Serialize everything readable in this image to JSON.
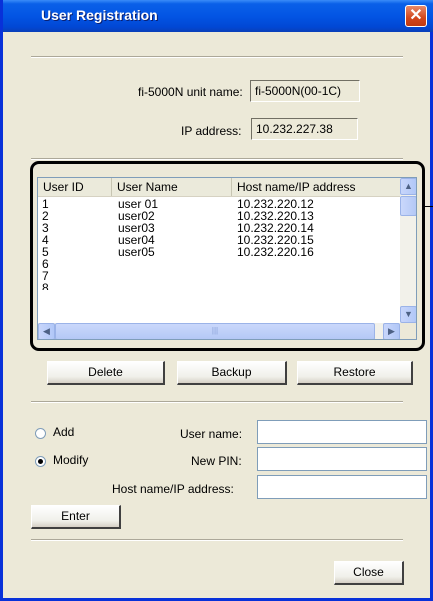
{
  "window": {
    "title": "User Registration",
    "close_glyph": "✕"
  },
  "unit": {
    "name_label": "fi-5000N unit name:",
    "name_value": "fi-5000N(00-1C)",
    "ip_label": "IP address:",
    "ip_value": "10.232.227.38"
  },
  "list": {
    "columns": [
      "User ID",
      "User Name",
      "Host name/IP address"
    ],
    "rows": [
      {
        "id": "1",
        "name": "user 01",
        "host": "10.232.220.12"
      },
      {
        "id": "2",
        "name": "user02",
        "host": "10.232.220.13"
      },
      {
        "id": "3",
        "name": "user03",
        "host": "10.232.220.14"
      },
      {
        "id": "4",
        "name": "user04",
        "host": "10.232.220.15"
      },
      {
        "id": "5",
        "name": "user05",
        "host": "10.232.220.16"
      },
      {
        "id": "6",
        "name": "",
        "host": ""
      },
      {
        "id": "7",
        "name": "",
        "host": ""
      },
      {
        "id": "8",
        "name": "",
        "host": ""
      }
    ]
  },
  "actions": {
    "delete": "Delete",
    "backup": "Backup",
    "restore": "Restore"
  },
  "form": {
    "mode_add": "Add",
    "mode_modify": "Modify",
    "selected_mode": "Modify",
    "user_name_label": "User name:",
    "user_name_value": "",
    "pin_label": "New PIN:",
    "pin_value": "",
    "host_label": "Host name/IP address:",
    "host_value": "",
    "enter": "Enter"
  },
  "footer": {
    "close": "Close"
  },
  "icons": {
    "scroll_up": "up-arrow-icon",
    "scroll_down": "down-arrow-icon",
    "scroll_left": "left-arrow-icon",
    "scroll_right": "right-arrow-icon"
  },
  "colors": {
    "title_bar": "#0355E4",
    "dialog_bg": "#ECE9D8",
    "close_button": "#D2461C"
  }
}
